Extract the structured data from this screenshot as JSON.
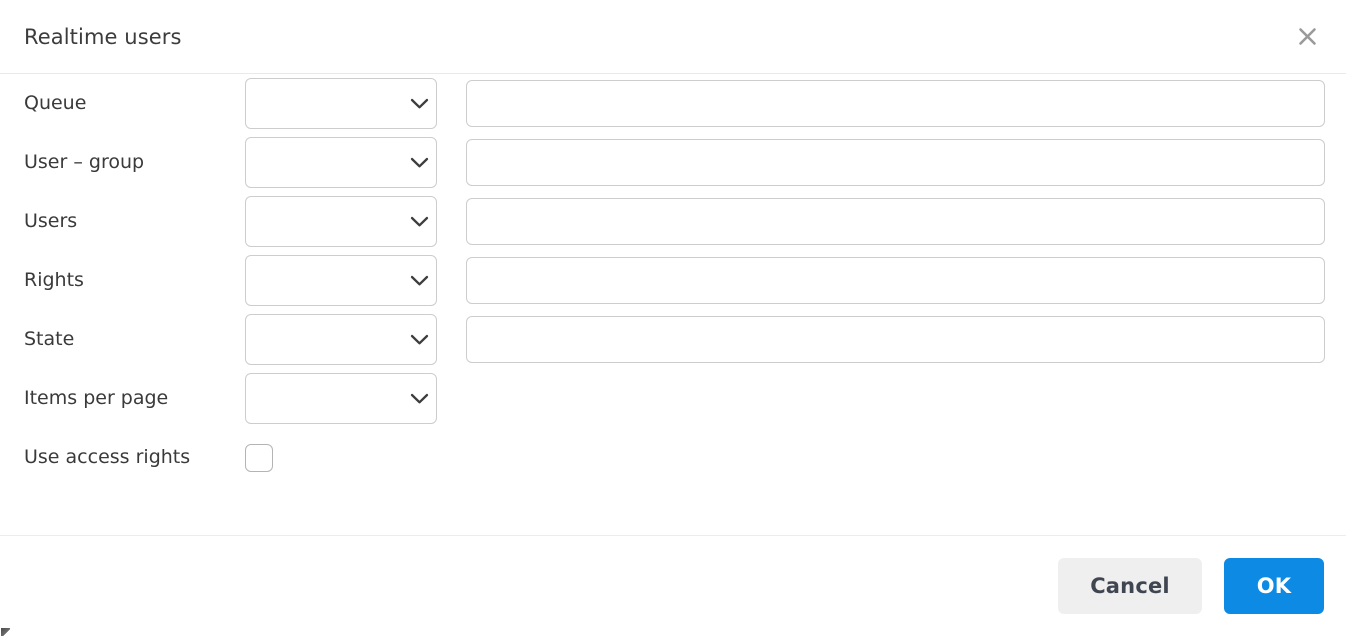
{
  "dialog": {
    "title": "Realtime users",
    "close_icon": "close-icon",
    "accent_color": "#0d8ae3",
    "cancel_color": "#efefef",
    "border_color": "#cdcdcd"
  },
  "form": {
    "rows": [
      {
        "label": "Queue",
        "select": {
          "value": "",
          "placeholder": "",
          "icon": "chevron-down-icon"
        },
        "input": {
          "value": "",
          "placeholder": ""
        }
      },
      {
        "label": "User – group",
        "select": {
          "value": "",
          "placeholder": "",
          "icon": "chevron-down-icon"
        },
        "input": {
          "value": "",
          "placeholder": ""
        }
      },
      {
        "label": "Users",
        "select": {
          "value": "",
          "placeholder": "",
          "icon": "chevron-down-icon"
        },
        "input": {
          "value": "",
          "placeholder": ""
        }
      },
      {
        "label": "Rights",
        "select": {
          "value": "",
          "placeholder": "",
          "icon": "chevron-down-icon"
        },
        "input": {
          "value": "",
          "placeholder": ""
        }
      },
      {
        "label": "State",
        "select": {
          "value": "",
          "placeholder": "",
          "icon": "chevron-down-icon"
        },
        "input": {
          "value": "",
          "placeholder": ""
        }
      },
      {
        "label": "Items per page",
        "select": {
          "value": "",
          "placeholder": "",
          "icon": "chevron-down-icon"
        },
        "input": null
      }
    ],
    "checkbox_row": {
      "label": "Use access rights",
      "checked": false
    }
  },
  "footer": {
    "cancel_label": "Cancel",
    "ok_label": "OK"
  }
}
